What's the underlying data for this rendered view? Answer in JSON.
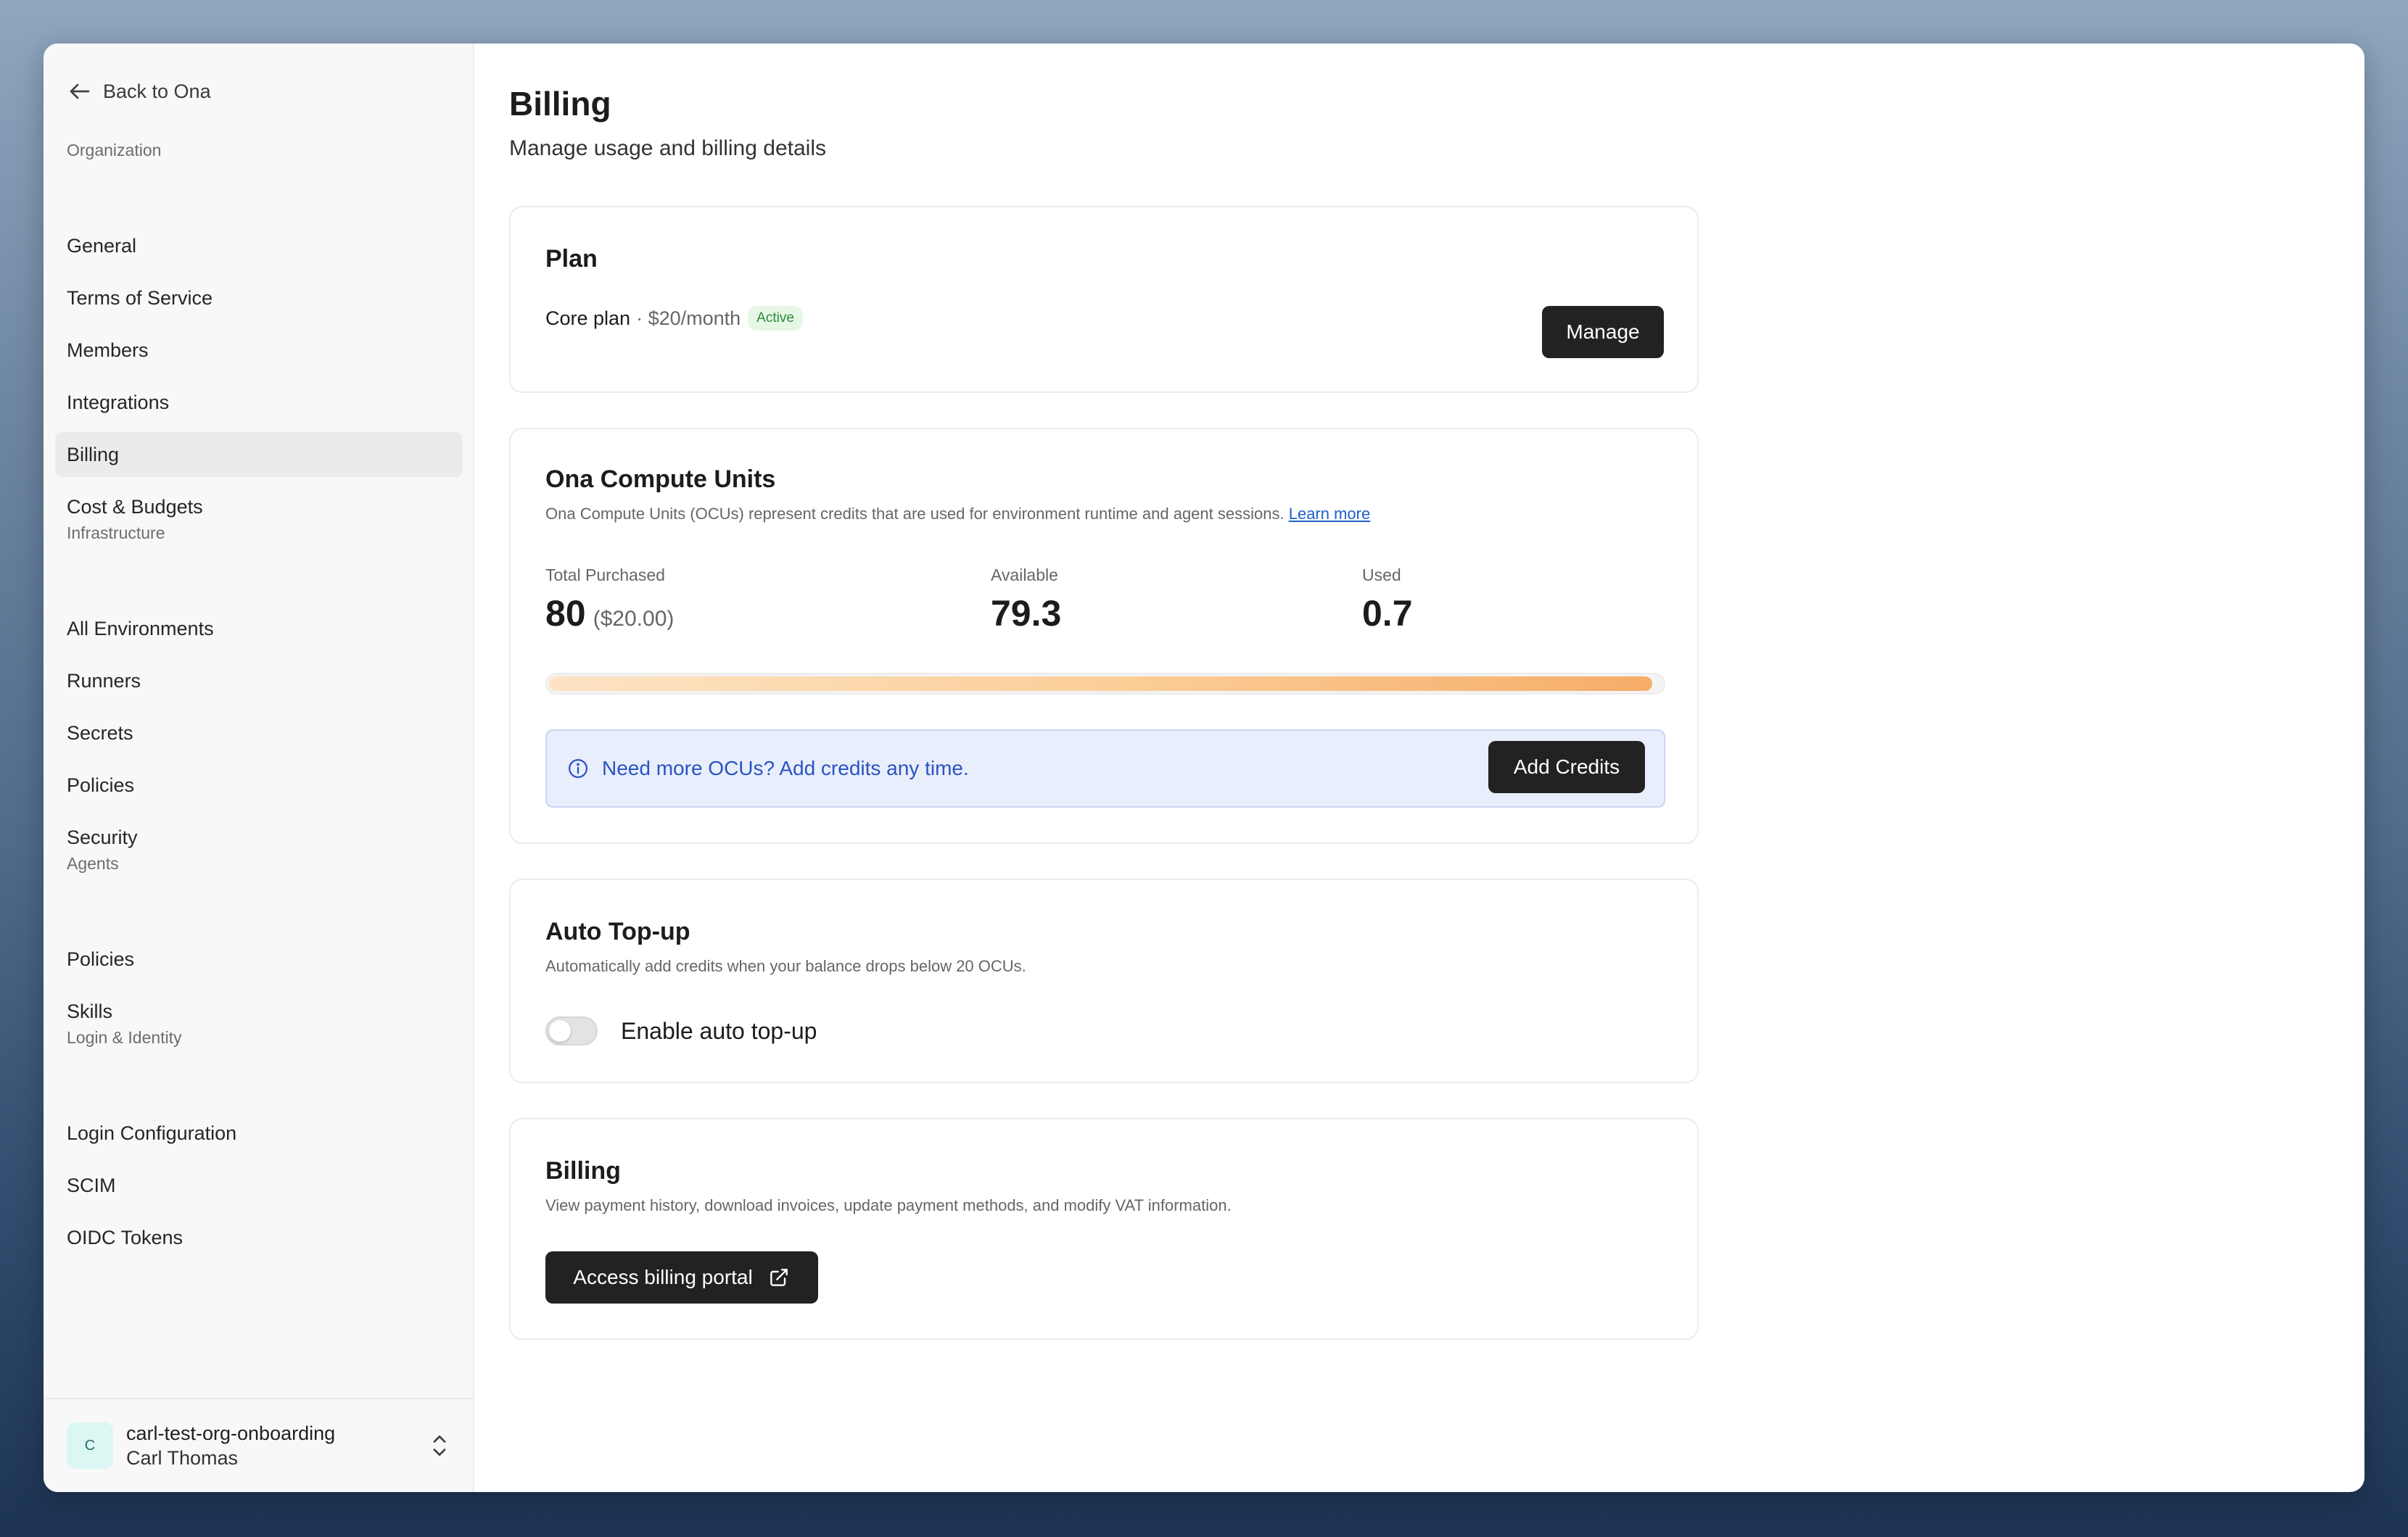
{
  "sidebar": {
    "back_label": "Back to Ona",
    "sections": {
      "organization": "Organization",
      "infrastructure": "Infrastructure",
      "agents": "Agents",
      "login_identity": "Login & Identity"
    },
    "items": {
      "general": "General",
      "terms": "Terms of Service",
      "members": "Members",
      "integrations": "Integrations",
      "billing": "Billing",
      "cost_budgets": "Cost & Budgets",
      "all_environments": "All Environments",
      "runners": "Runners",
      "secrets": "Secrets",
      "policies_infra": "Policies",
      "security": "Security",
      "policies_agents": "Policies",
      "skills": "Skills",
      "login_configuration": "Login Configuration",
      "scim": "SCIM",
      "oidc_tokens": "OIDC Tokens"
    },
    "active_item": "billing",
    "org": {
      "avatar_letter": "C",
      "name": "carl-test-org-onboarding",
      "user": "Carl Thomas",
      "avatar_color": "#dbf7f3"
    }
  },
  "page": {
    "title": "Billing",
    "subtitle": "Manage usage and billing details"
  },
  "plan": {
    "title": "Plan",
    "name": "Core plan",
    "price": "· $20/month",
    "status": "Active",
    "manage_label": "Manage"
  },
  "ocu": {
    "title": "Ona Compute Units",
    "description": "Ona Compute Units (OCUs) represent credits that are used for environment runtime and agent sessions.",
    "learn_more": "Learn more",
    "total_label": "Total Purchased",
    "total_value": "80",
    "total_sub": "($20.00)",
    "available_label": "Available",
    "available_value": "79.3",
    "used_label": "Used",
    "used_value": "0.7",
    "available_fraction": 0.99125,
    "info_text": "Need more OCUs? Add credits any time.",
    "add_credits_label": "Add Credits"
  },
  "topup": {
    "title": "Auto Top-up",
    "description": "Automatically add credits when your balance drops below 20 OCUs.",
    "toggle_label": "Enable auto top-up",
    "enabled": false
  },
  "billing_portal": {
    "title": "Billing",
    "description": "View payment history, download invoices, update payment methods, and modify VAT information.",
    "button_label": "Access billing portal"
  },
  "colors": {
    "accent_dark": "#222222",
    "active_badge_bg": "#e6f7e6",
    "active_badge_text": "#2f8a3a",
    "info_bg": "#e9eefc",
    "info_text": "#2a54c2",
    "progress_end": "#f6ad68"
  }
}
